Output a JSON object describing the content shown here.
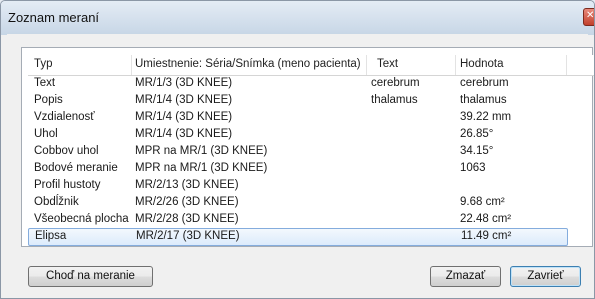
{
  "window": {
    "title": "Zoznam meraní"
  },
  "table": {
    "columns": [
      "Typ",
      "Umiestnenie: Séria/Snímka (meno pacienta)",
      "Text",
      "Hodnota"
    ],
    "rows": [
      [
        "Text",
        "MR/1/3  (3D KNEE)",
        "cerebrum",
        "cerebrum"
      ],
      [
        "Popis",
        "MR/1/4  (3D KNEE)",
        "thalamus",
        "thalamus"
      ],
      [
        "Vzdialenosť",
        "MR/1/4  (3D KNEE)",
        "",
        "39.22 mm"
      ],
      [
        "Uhol",
        "MR/1/4  (3D KNEE)",
        "",
        "26.85°"
      ],
      [
        "Cobbov uhol",
        "MPR na MR/1  (3D KNEE)",
        "",
        "34.15°"
      ],
      [
        "Bodové meranie",
        "MPR na MR/1  (3D KNEE)",
        "",
        "1063"
      ],
      [
        "Profil hustoty",
        "MR/2/13  (3D KNEE)",
        "",
        ""
      ],
      [
        "Obdĺžnik",
        "MR/2/26  (3D KNEE)",
        "",
        " 9.68 cm²"
      ],
      [
        "Všeobecná plocha",
        "MR/2/28  (3D KNEE)",
        "",
        "22.48 cm²"
      ],
      [
        "Elipsa",
        "MR/2/17  (3D KNEE)",
        "",
        "11.49 cm²"
      ]
    ],
    "selected_row": 9
  },
  "buttons": {
    "go_to": "Choď na meranie",
    "delete": "Zmazať",
    "close": "Zavrieť"
  },
  "icons": {
    "close": "close-icon"
  },
  "colors": {
    "selection": "#dcebfc",
    "selection_border": "#84acdd"
  }
}
